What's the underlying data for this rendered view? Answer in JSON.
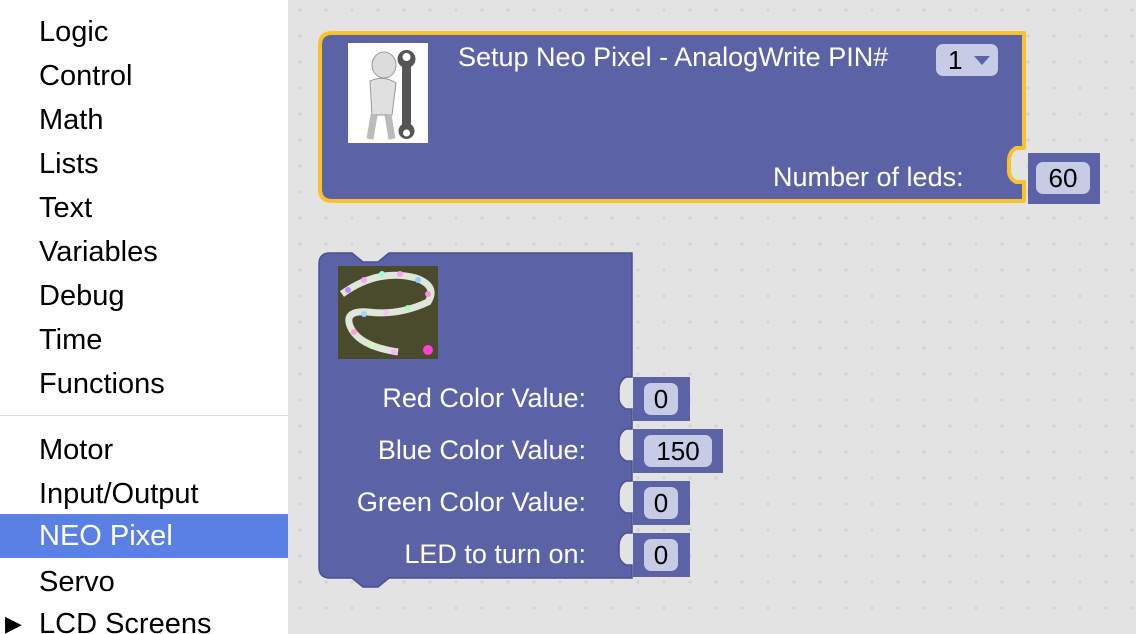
{
  "toolbox": {
    "items": [
      {
        "label": "Logic"
      },
      {
        "label": "Control"
      },
      {
        "label": "Math"
      },
      {
        "label": "Lists"
      },
      {
        "label": "Text"
      },
      {
        "label": "Variables"
      },
      {
        "label": "Debug"
      },
      {
        "label": "Time"
      },
      {
        "label": "Functions"
      },
      {
        "label": "Motor"
      },
      {
        "label": "Input/Output"
      },
      {
        "label": "NEO Pixel"
      },
      {
        "label": "Servo"
      },
      {
        "label": "LCD Screens"
      }
    ],
    "selected": "NEO Pixel",
    "expand_icon": "triangle-right-icon"
  },
  "setup_block": {
    "title": "Setup Neo Pixel - AnalogWrite PIN#",
    "pin_value": "1",
    "leds_label": "Number of leds:",
    "leds_value": "60",
    "image": "man-with-wrench-icon",
    "highlight_color": "#f6c32e"
  },
  "color_block": {
    "image": "led-strip-photo",
    "inputs": [
      {
        "label": "Red Color Value:",
        "value": "0"
      },
      {
        "label": "Blue Color Value:",
        "value": "150"
      },
      {
        "label": "Green Color Value:",
        "value": "0"
      },
      {
        "label": "LED to turn on:",
        "value": "0"
      }
    ]
  },
  "colors": {
    "block": "#5b62a6",
    "field": "#c8cbe6",
    "workspace": "#e3e3e3",
    "selected": "#5b80e5"
  }
}
